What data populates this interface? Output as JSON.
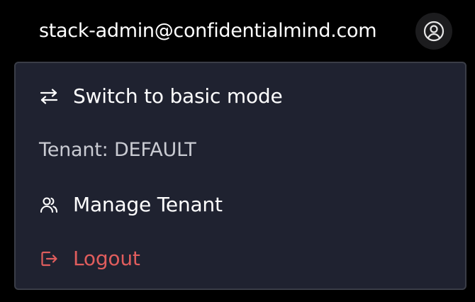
{
  "header": {
    "user_email": "stack-admin@confidentialmind.com",
    "avatar_icon": "user-circle-icon"
  },
  "menu": {
    "switch_mode": {
      "label": "Switch to basic mode",
      "icon": "arrows-left-right-icon"
    },
    "tenant": {
      "label": "Tenant: DEFAULT"
    },
    "manage_tenant": {
      "label": "Manage Tenant",
      "icon": "users-icon"
    },
    "logout": {
      "label": "Logout",
      "icon": "logout-icon"
    }
  },
  "colors": {
    "page_bg": "#000000",
    "menu_bg": "#1f2230",
    "menu_border": "#3a3d47",
    "text": "#ffffff",
    "muted_text": "#c9cbd2",
    "danger": "#e05d5d",
    "avatar_bg": "#1c1c1e"
  }
}
